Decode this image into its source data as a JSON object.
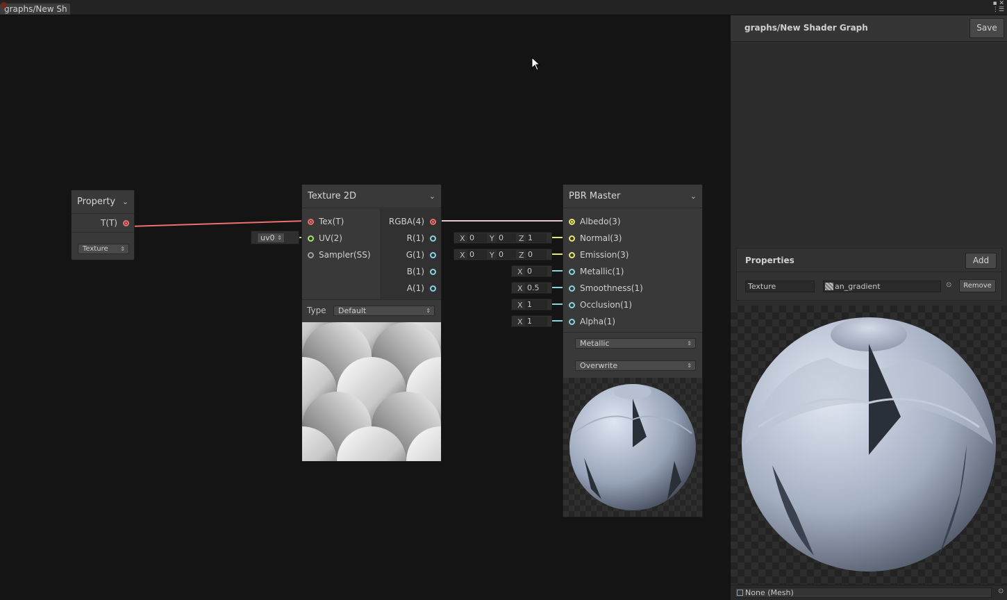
{
  "window": {
    "tab_title": "graphs/New Sh",
    "controls": "▪ ✕"
  },
  "nodes": {
    "property": {
      "title": "Property",
      "output_label": "T(T)",
      "dropdown": "Texture"
    },
    "texture2d": {
      "title": "Texture 2D",
      "inputs": [
        "Tex(T)",
        "UV(2)",
        "Sampler(SS)"
      ],
      "outputs": [
        "RGBA(4)",
        "R(1)",
        "G(1)",
        "B(1)",
        "A(1)"
      ],
      "type_label": "Type",
      "type_value": "Default",
      "uv_dropdown": "uv0"
    },
    "pbr_master": {
      "title": "PBR Master",
      "inputs": [
        "Albedo(3)",
        "Normal(3)",
        "Emission(3)",
        "Metallic(1)",
        "Smoothness(1)",
        "Occlusion(1)",
        "Alpha(1)"
      ],
      "workflow": "Metallic",
      "surface": "Overwrite",
      "normal_vec": {
        "x_label": "X",
        "x": "0",
        "y_label": "Y",
        "y": "0",
        "z_label": "Z",
        "z": "1"
      },
      "emission_vec": {
        "x_label": "X",
        "x": "0",
        "y_label": "Y",
        "y": "0",
        "z_label": "Z",
        "z": "0"
      },
      "metallic": {
        "label": "X",
        "value": "0"
      },
      "smoothness": {
        "label": "X",
        "value": "0.5"
      },
      "occlusion": {
        "label": "X",
        "value": "1"
      },
      "alpha": {
        "label": "X",
        "value": "1"
      }
    }
  },
  "inspector": {
    "title": "graphs/New Shader Graph",
    "save_label": "Save",
    "properties_title": "Properties",
    "add_label": "Add",
    "property_row": {
      "name": "Texture",
      "value": "an_gradient",
      "remove_label": "Remove"
    },
    "mesh_label": "None (Mesh)"
  },
  "colors": {
    "texture_wire": "#f07070",
    "uv_wire": "#a6e46c",
    "vector3_wire": "#e8e86a",
    "vector1_wire": "#8ad5e0"
  }
}
